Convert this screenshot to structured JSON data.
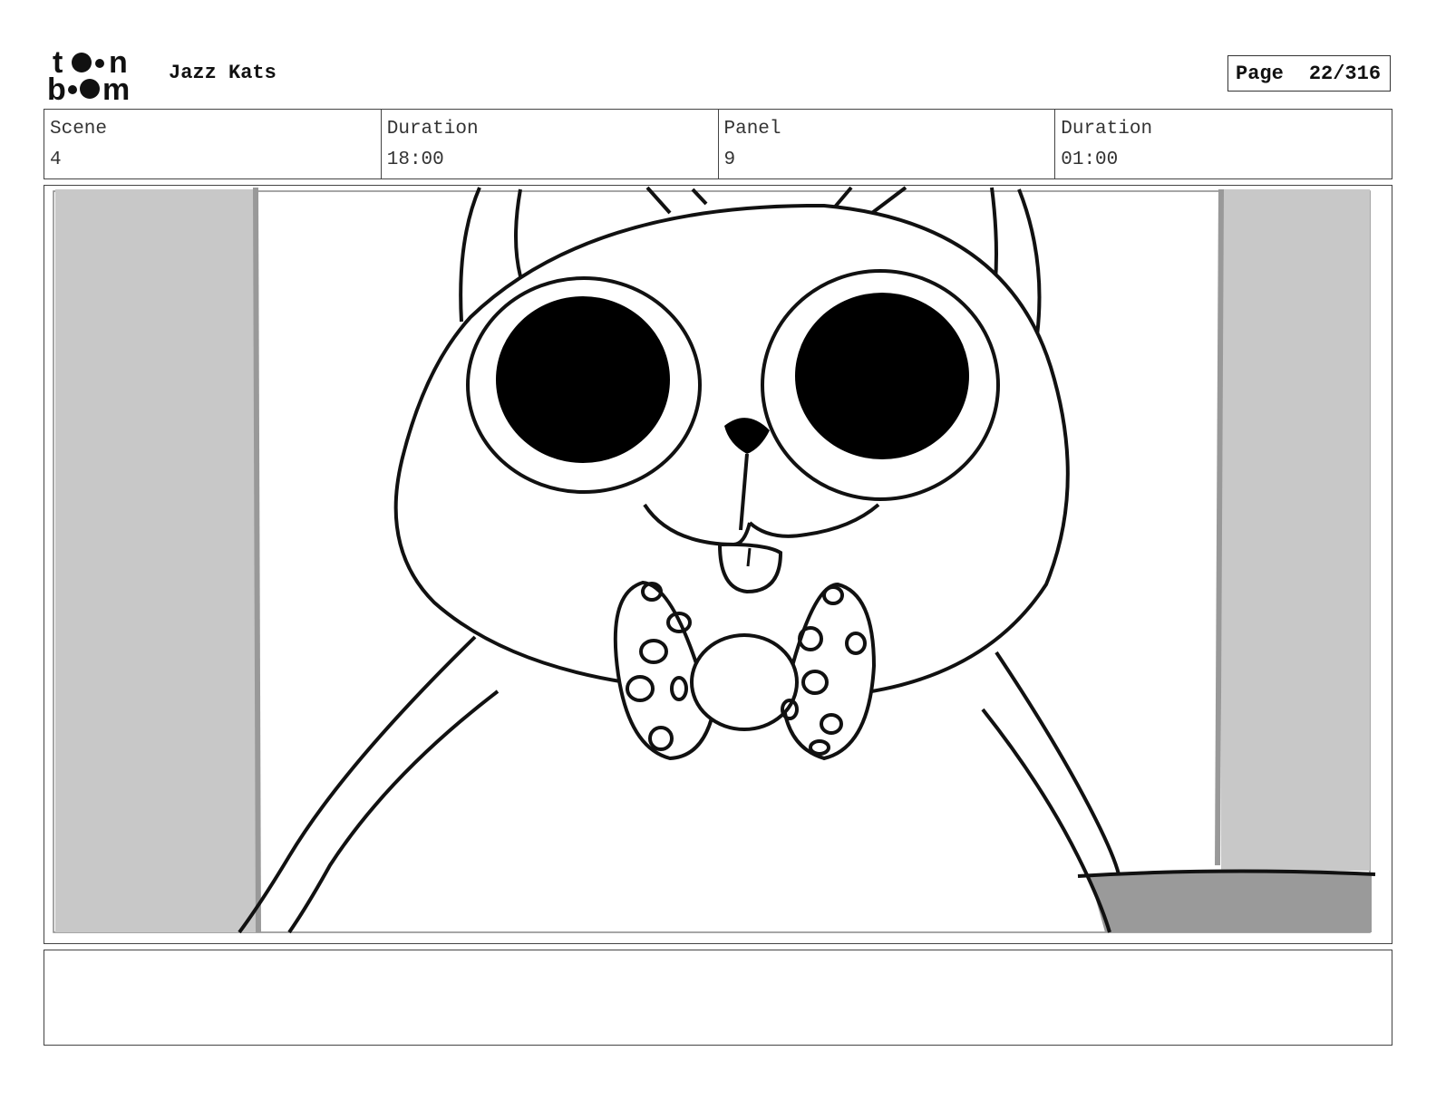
{
  "header": {
    "project_title": "Jazz Kats",
    "page_label": "Page",
    "page_value": "22/316"
  },
  "info": {
    "scene_label": "Scene",
    "scene_value": "4",
    "scene_duration_label": "Duration",
    "scene_duration_value": "18:00",
    "panel_label": "Panel",
    "panel_value": "9",
    "panel_duration_label": "Duration",
    "panel_duration_value": "01:00"
  },
  "notes": {
    "text": ""
  },
  "colors": {
    "border": "#444444",
    "gray_wall": "#c8c8c8",
    "dark_gray": "#9a9a9a"
  }
}
